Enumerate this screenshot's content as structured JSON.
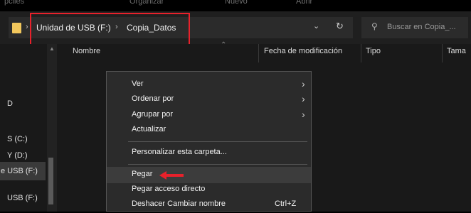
{
  "ribbon": {
    "items": [
      "pciles",
      "Organizar",
      "Nuevo",
      "Abrir"
    ]
  },
  "address_bar": {
    "path": [
      "Unidad de USB (F:)",
      "Copia_Datos"
    ],
    "separator": "›",
    "dropdown_icon": "chevron-down-icon",
    "refresh_icon": "refresh-icon"
  },
  "search": {
    "placeholder": "Buscar en Copia_...",
    "icon": "search-icon"
  },
  "sidebar": {
    "items": [
      "D",
      "S (C:)",
      "Y (D:)",
      "e USB (F:)",
      "USB (F:)"
    ],
    "selected_index": 3
  },
  "columns": [
    "Nombre",
    "Fecha de modificación",
    "Tipo",
    "Tama"
  ],
  "context_menu": {
    "groups": [
      [
        {
          "label": "Ver",
          "submenu": true
        },
        {
          "label": "Ordenar por",
          "submenu": true
        },
        {
          "label": "Agrupar por",
          "submenu": true
        },
        {
          "label": "Actualizar",
          "submenu": false
        }
      ],
      [
        {
          "label": "Personalizar esta carpeta...",
          "submenu": false
        }
      ],
      [
        {
          "label": "Pegar",
          "submenu": false,
          "highlighted": true
        },
        {
          "label": "Pegar acceso directo",
          "submenu": false
        },
        {
          "label": "Deshacer Cambiar nombre",
          "shortcut": "Ctrl+Z"
        }
      ]
    ],
    "submenu_glyph": "›"
  },
  "colors": {
    "highlight_border": "#e8212b",
    "arrow": "#e8212b",
    "folder": "#f2c75c",
    "menu_bg": "#2b2b2b"
  }
}
